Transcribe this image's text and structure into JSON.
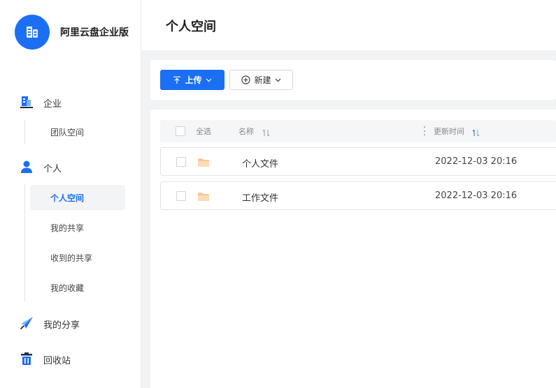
{
  "brand": {
    "name": "阿里云盘企业版"
  },
  "sidebar": {
    "groups": [
      {
        "label": "企业",
        "icon": "enterprise-building-icon"
      },
      {
        "label": "个人",
        "icon": "person-icon"
      },
      {
        "label": "我的分享",
        "icon": "paper-plane-icon"
      },
      {
        "label": "回收站",
        "icon": "trash-bin-icon"
      }
    ],
    "enterprise_items": [
      {
        "label": "团队空间"
      }
    ],
    "personal_items": [
      {
        "label": "个人空间",
        "active": true
      },
      {
        "label": "我的共享"
      },
      {
        "label": "收到的共享"
      },
      {
        "label": "我的收藏"
      }
    ]
  },
  "header": {
    "title": "个人空间"
  },
  "toolbar": {
    "upload_label": "上传",
    "new_label": "新建"
  },
  "table": {
    "headers": {
      "select_all": "全选",
      "name": "名称",
      "modified": "更新时间"
    },
    "rows": [
      {
        "name": "个人文件",
        "modified": "2022-12-03 20:16",
        "icon": "folder-icon"
      },
      {
        "name": "工作文件",
        "modified": "2022-12-03 20:16",
        "icon": "folder-icon"
      }
    ]
  },
  "colors": {
    "accent": "#1a6ff5",
    "folder": "#f9c89a",
    "background": "#f2f3f5"
  }
}
